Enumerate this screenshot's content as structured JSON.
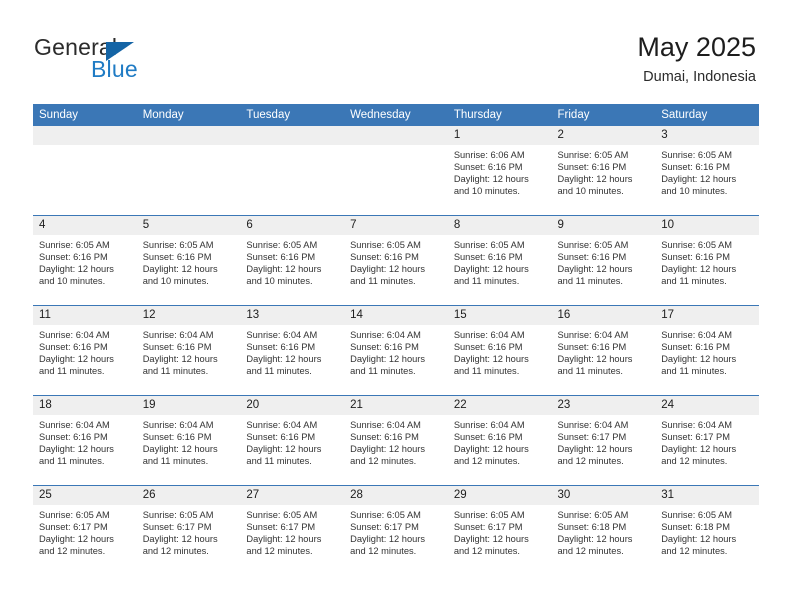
{
  "brand": {
    "name_part1": "General",
    "name_part2": "Blue",
    "triangle_color": "#1464a5",
    "blue_color": "#1f7bc4"
  },
  "header": {
    "title": "May 2025",
    "subtitle": "Dumai, Indonesia"
  },
  "theme": {
    "header_blue": "#3b77b6",
    "daynum_gray": "#efefef",
    "text": "#333333"
  },
  "weekdays": [
    "Sunday",
    "Monday",
    "Tuesday",
    "Wednesday",
    "Thursday",
    "Friday",
    "Saturday"
  ],
  "labels": {
    "sunrise_prefix": "Sunrise:",
    "sunset_prefix": "Sunset:",
    "daylight_prefix": "Daylight:"
  },
  "weeks": [
    [
      {
        "day": "",
        "empty": true
      },
      {
        "day": "",
        "empty": true
      },
      {
        "day": "",
        "empty": true
      },
      {
        "day": "",
        "empty": true
      },
      {
        "day": "1",
        "sunrise": "Sunrise: 6:06 AM",
        "sunset": "Sunset: 6:16 PM",
        "daylight": "Daylight: 12 hours and 10 minutes."
      },
      {
        "day": "2",
        "sunrise": "Sunrise: 6:05 AM",
        "sunset": "Sunset: 6:16 PM",
        "daylight": "Daylight: 12 hours and 10 minutes."
      },
      {
        "day": "3",
        "sunrise": "Sunrise: 6:05 AM",
        "sunset": "Sunset: 6:16 PM",
        "daylight": "Daylight: 12 hours and 10 minutes."
      }
    ],
    [
      {
        "day": "4",
        "sunrise": "Sunrise: 6:05 AM",
        "sunset": "Sunset: 6:16 PM",
        "daylight": "Daylight: 12 hours and 10 minutes."
      },
      {
        "day": "5",
        "sunrise": "Sunrise: 6:05 AM",
        "sunset": "Sunset: 6:16 PM",
        "daylight": "Daylight: 12 hours and 10 minutes."
      },
      {
        "day": "6",
        "sunrise": "Sunrise: 6:05 AM",
        "sunset": "Sunset: 6:16 PM",
        "daylight": "Daylight: 12 hours and 10 minutes."
      },
      {
        "day": "7",
        "sunrise": "Sunrise: 6:05 AM",
        "sunset": "Sunset: 6:16 PM",
        "daylight": "Daylight: 12 hours and 11 minutes."
      },
      {
        "day": "8",
        "sunrise": "Sunrise: 6:05 AM",
        "sunset": "Sunset: 6:16 PM",
        "daylight": "Daylight: 12 hours and 11 minutes."
      },
      {
        "day": "9",
        "sunrise": "Sunrise: 6:05 AM",
        "sunset": "Sunset: 6:16 PM",
        "daylight": "Daylight: 12 hours and 11 minutes."
      },
      {
        "day": "10",
        "sunrise": "Sunrise: 6:05 AM",
        "sunset": "Sunset: 6:16 PM",
        "daylight": "Daylight: 12 hours and 11 minutes."
      }
    ],
    [
      {
        "day": "11",
        "sunrise": "Sunrise: 6:04 AM",
        "sunset": "Sunset: 6:16 PM",
        "daylight": "Daylight: 12 hours and 11 minutes."
      },
      {
        "day": "12",
        "sunrise": "Sunrise: 6:04 AM",
        "sunset": "Sunset: 6:16 PM",
        "daylight": "Daylight: 12 hours and 11 minutes."
      },
      {
        "day": "13",
        "sunrise": "Sunrise: 6:04 AM",
        "sunset": "Sunset: 6:16 PM",
        "daylight": "Daylight: 12 hours and 11 minutes."
      },
      {
        "day": "14",
        "sunrise": "Sunrise: 6:04 AM",
        "sunset": "Sunset: 6:16 PM",
        "daylight": "Daylight: 12 hours and 11 minutes."
      },
      {
        "day": "15",
        "sunrise": "Sunrise: 6:04 AM",
        "sunset": "Sunset: 6:16 PM",
        "daylight": "Daylight: 12 hours and 11 minutes."
      },
      {
        "day": "16",
        "sunrise": "Sunrise: 6:04 AM",
        "sunset": "Sunset: 6:16 PM",
        "daylight": "Daylight: 12 hours and 11 minutes."
      },
      {
        "day": "17",
        "sunrise": "Sunrise: 6:04 AM",
        "sunset": "Sunset: 6:16 PM",
        "daylight": "Daylight: 12 hours and 11 minutes."
      }
    ],
    [
      {
        "day": "18",
        "sunrise": "Sunrise: 6:04 AM",
        "sunset": "Sunset: 6:16 PM",
        "daylight": "Daylight: 12 hours and 11 minutes."
      },
      {
        "day": "19",
        "sunrise": "Sunrise: 6:04 AM",
        "sunset": "Sunset: 6:16 PM",
        "daylight": "Daylight: 12 hours and 11 minutes."
      },
      {
        "day": "20",
        "sunrise": "Sunrise: 6:04 AM",
        "sunset": "Sunset: 6:16 PM",
        "daylight": "Daylight: 12 hours and 11 minutes."
      },
      {
        "day": "21",
        "sunrise": "Sunrise: 6:04 AM",
        "sunset": "Sunset: 6:16 PM",
        "daylight": "Daylight: 12 hours and 12 minutes."
      },
      {
        "day": "22",
        "sunrise": "Sunrise: 6:04 AM",
        "sunset": "Sunset: 6:16 PM",
        "daylight": "Daylight: 12 hours and 12 minutes."
      },
      {
        "day": "23",
        "sunrise": "Sunrise: 6:04 AM",
        "sunset": "Sunset: 6:17 PM",
        "daylight": "Daylight: 12 hours and 12 minutes."
      },
      {
        "day": "24",
        "sunrise": "Sunrise: 6:04 AM",
        "sunset": "Sunset: 6:17 PM",
        "daylight": "Daylight: 12 hours and 12 minutes."
      }
    ],
    [
      {
        "day": "25",
        "sunrise": "Sunrise: 6:05 AM",
        "sunset": "Sunset: 6:17 PM",
        "daylight": "Daylight: 12 hours and 12 minutes."
      },
      {
        "day": "26",
        "sunrise": "Sunrise: 6:05 AM",
        "sunset": "Sunset: 6:17 PM",
        "daylight": "Daylight: 12 hours and 12 minutes."
      },
      {
        "day": "27",
        "sunrise": "Sunrise: 6:05 AM",
        "sunset": "Sunset: 6:17 PM",
        "daylight": "Daylight: 12 hours and 12 minutes."
      },
      {
        "day": "28",
        "sunrise": "Sunrise: 6:05 AM",
        "sunset": "Sunset: 6:17 PM",
        "daylight": "Daylight: 12 hours and 12 minutes."
      },
      {
        "day": "29",
        "sunrise": "Sunrise: 6:05 AM",
        "sunset": "Sunset: 6:17 PM",
        "daylight": "Daylight: 12 hours and 12 minutes."
      },
      {
        "day": "30",
        "sunrise": "Sunrise: 6:05 AM",
        "sunset": "Sunset: 6:18 PM",
        "daylight": "Daylight: 12 hours and 12 minutes."
      },
      {
        "day": "31",
        "sunrise": "Sunrise: 6:05 AM",
        "sunset": "Sunset: 6:18 PM",
        "daylight": "Daylight: 12 hours and 12 minutes."
      }
    ]
  ]
}
